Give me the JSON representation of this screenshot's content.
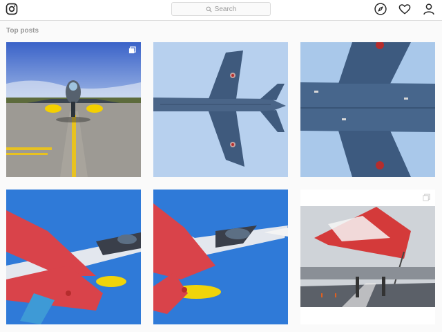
{
  "header": {
    "logo_icon": "instagram-icon",
    "search": {
      "placeholder": "Search",
      "icon": "search-icon"
    },
    "nav_icons": [
      "explore-compass-icon",
      "heart-icon",
      "profile-icon"
    ]
  },
  "section": {
    "title": "Top posts"
  },
  "posts": [
    {
      "subject": "jet on runway, front view",
      "multi": true
    },
    {
      "subject": "jet underside in blue sky",
      "multi": false
    },
    {
      "subject": "jet underside close-up",
      "multi": false
    },
    {
      "subject": "red painted jet in flight",
      "multi": false
    },
    {
      "subject": "red painted jet banking",
      "multi": false
    },
    {
      "subject": "festival flag waving on street",
      "multi": true
    }
  ],
  "colors": {
    "border": "#dbdbdb",
    "muted": "#999999",
    "background": "#fafafa"
  }
}
